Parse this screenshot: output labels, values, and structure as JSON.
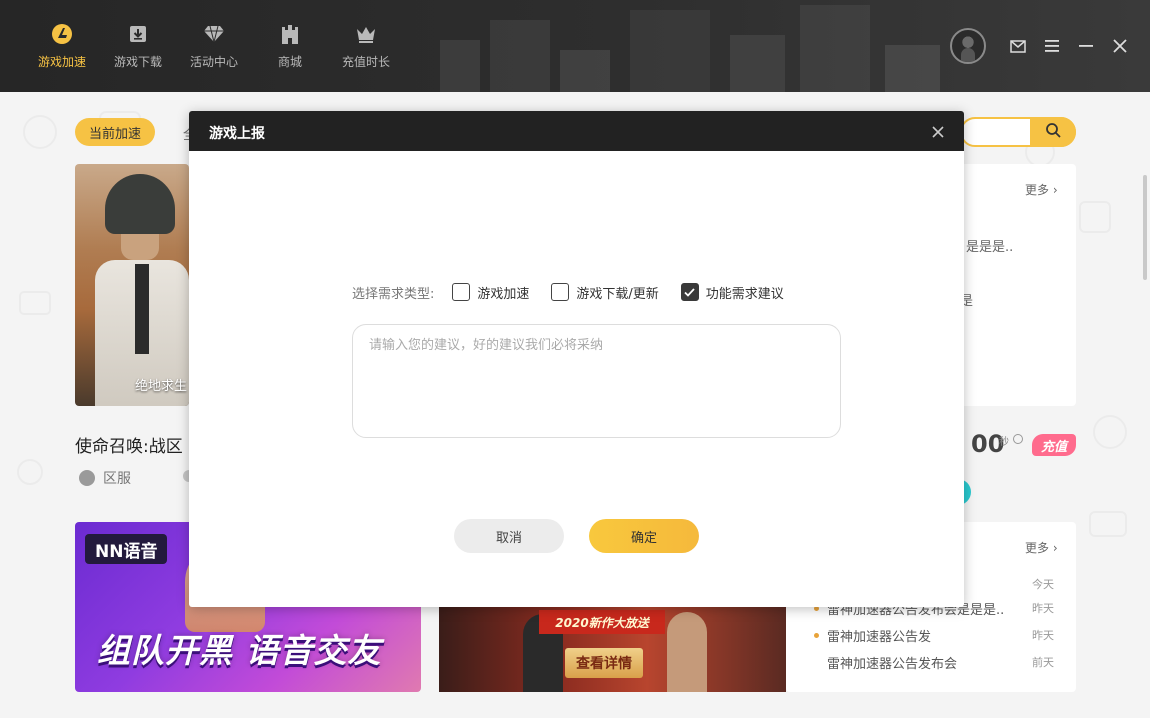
{
  "nav": {
    "items": [
      {
        "label": "游戏加速",
        "icon": "speed-logo-icon",
        "active": true
      },
      {
        "label": "游戏下载",
        "icon": "download-box-icon",
        "active": false
      },
      {
        "label": "活动中心",
        "icon": "diamond-icon",
        "active": false
      },
      {
        "label": "商城",
        "icon": "castle-icon",
        "active": false
      },
      {
        "label": "充值时长",
        "icon": "crown-icon",
        "active": false
      }
    ],
    "active_color": "#f6c244"
  },
  "window_controls": {
    "avatar": "user-avatar",
    "icons": [
      "mail-icon",
      "menu-icon",
      "minimize-icon",
      "close-icon"
    ]
  },
  "background": {
    "current_pill": "当前加速",
    "tab_partial": "全",
    "search_icon": "search-icon",
    "game_card_title": "绝地求生",
    "game_name": "使命召唤:战区",
    "region": "区服",
    "more_1": "更多",
    "more_2": "更多",
    "news_fragment_1": "是是是..",
    "news_fragment_2": "是",
    "time_value": "00",
    "time_unit": "秒",
    "charge_badge": "充值",
    "banner1_tag": "NN语音",
    "banner1_slogan": "组队开黑 语音交友",
    "banner2_ribbon": "2020新作大放送",
    "banner2_button": "查看详情",
    "news": [
      {
        "title": "",
        "date": "今天",
        "bullet": false
      },
      {
        "title": "雷神加速器公告发布会是是是..",
        "date": "昨天",
        "bullet": true
      },
      {
        "title": "雷神加速器公告发",
        "date": "昨天",
        "bullet": true
      },
      {
        "title": "雷神加速器公告发布会",
        "date": "前天",
        "bullet": false
      }
    ]
  },
  "modal": {
    "title": "游戏上报",
    "type_label": "选择需求类型:",
    "options": [
      {
        "label": "游戏加速",
        "checked": false
      },
      {
        "label": "游戏下载/更新",
        "checked": false
      },
      {
        "label": "功能需求建议",
        "checked": true
      }
    ],
    "suggestion_value": "",
    "suggestion_placeholder": "请输入您的建议，好的建议我们必将采纳",
    "cancel_label": "取消",
    "confirm_label": "确定",
    "confirm_color": "#f6c244"
  }
}
